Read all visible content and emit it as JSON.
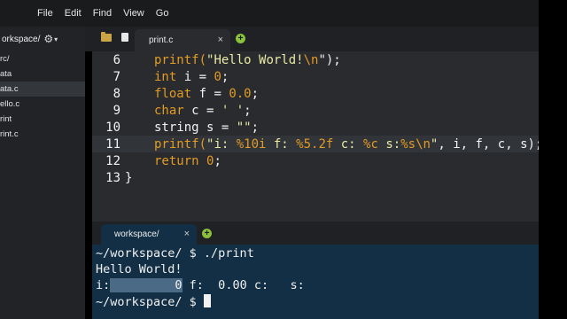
{
  "menu": [
    "File",
    "Edit",
    "Find",
    "View",
    "Go"
  ],
  "sidebar": {
    "workspace_label": "orkspace/",
    "items": [
      "rc/",
      "ata",
      "ata.c",
      "ello.c",
      "rint",
      "rint.c"
    ],
    "selected_index": 2
  },
  "editor": {
    "tab_label": "print.c",
    "close_glyph": "×",
    "add_glyph": "+",
    "lines": [
      {
        "n": "6"
      },
      {
        "n": "7"
      },
      {
        "n": "8"
      },
      {
        "n": "9"
      },
      {
        "n": "10"
      },
      {
        "n": "11"
      },
      {
        "n": "12"
      },
      {
        "n": "13"
      }
    ],
    "code": {
      "l6_fn": "printf(",
      "l6_str": "\"Hello World!",
      "l6_esc": "\\n",
      "l6_end": "\");",
      "l7_kw": "int",
      "l7_rest": " i = ",
      "l7_num": "0",
      "l7_end": ";",
      "l8_kw": "float",
      "l8_rest": " f = ",
      "l8_num": "0.0",
      "l8_end": ";",
      "l9_kw": "char",
      "l9_rest": " c = ",
      "l9_str": "' '",
      "l9_end": ";",
      "l10_type": "string s = ",
      "l10_str": "\"\"",
      "l10_end": ";",
      "l11_fn": "printf(",
      "l11_s1": "\"i: ",
      "l11_f1": "%10i",
      "l11_s2": " f: ",
      "l11_f2": "%5.2f",
      "l11_s3": " c: ",
      "l11_f3": "%c",
      "l11_s4": " s:",
      "l11_f4": "%s",
      "l11_e": "\\n",
      "l11_s5": "\"",
      "l11_end": ", i, f, c, s);",
      "l12_kw": "return",
      "l12_sp": " ",
      "l12_num": "0",
      "l12_end": ";",
      "l13": "}"
    }
  },
  "terminal": {
    "tab_label": "workspace/",
    "close_glyph": "×",
    "add_glyph": "+",
    "prompt1": "~/workspace/ $ ",
    "cmd1": "./print",
    "out1": "Hello World!",
    "out2_a": "i:",
    "out2_sel": "         0",
    "out2_b": " f:  0.00 c:   s:",
    "prompt2": "~/workspace/ $ "
  }
}
